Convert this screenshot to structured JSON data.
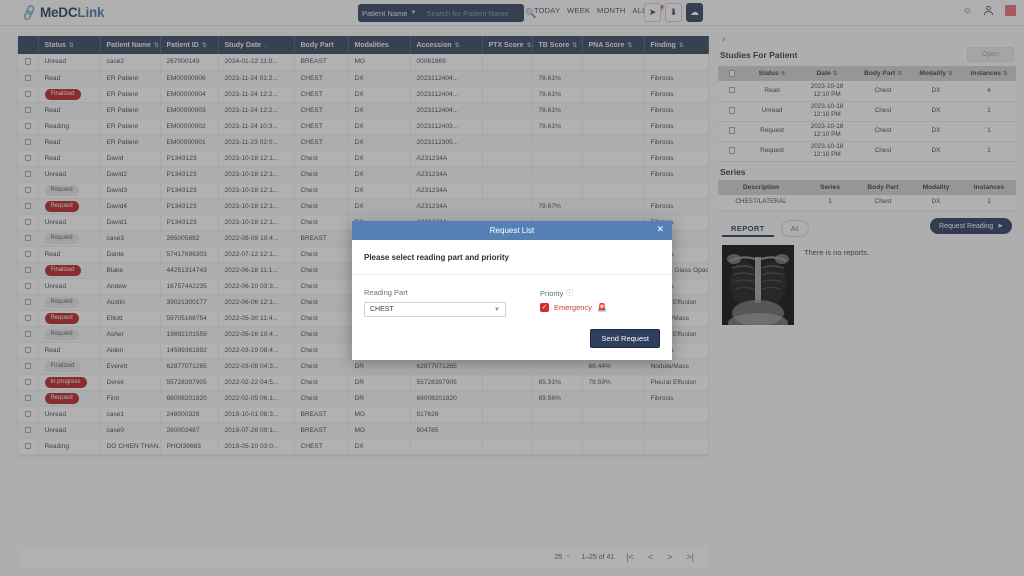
{
  "app": {
    "brand_main": "MeDC",
    "brand_lite": "Link",
    "brand_icon": "link-icon"
  },
  "header": {
    "search_scope": "Patient Name",
    "search_placeholder": "Search for Patient Name",
    "search_value": "",
    "search_icon": "search-icon",
    "date_filters": [
      "TODAY",
      "WEEK",
      "MONTH",
      "ALL"
    ],
    "calendar_icon": "calendar-icon",
    "icon_buttons": [
      "send-icon",
      "download-icon",
      "cloud-upload-icon"
    ],
    "right_icons": [
      "brightness-icon",
      "user-icon",
      "app-square-icon"
    ]
  },
  "worklist": {
    "columns": [
      "Status",
      "Patient Name",
      "Patient ID",
      "Study Date",
      "Body Part",
      "Modalities",
      "Accession",
      "PTX Score",
      "TB Score",
      "PNA Score",
      "Finding"
    ],
    "sorted_column": "Study Date",
    "sort_direction": "desc",
    "rows": [
      {
        "status": "Unread",
        "badge": "none",
        "name": "case2",
        "id": "267000149",
        "date": "2024-01-12 11:0...",
        "body": "BREAST",
        "mod": "MG",
        "acc": "00061869",
        "ptx": "",
        "tb": "",
        "pna": "",
        "finding": ""
      },
      {
        "status": "Read",
        "badge": "none",
        "name": "ER Patient",
        "id": "EM00000006",
        "date": "2023-11-24 01:2...",
        "body": "CHEST",
        "mod": "DX",
        "acc": "2023112404...",
        "ptx": "",
        "tb": "78.61%",
        "pna": "",
        "finding": "Fibrosis"
      },
      {
        "status": "Finalized",
        "badge": "red",
        "name": "ER Patient",
        "id": "EM00000004",
        "date": "2023-11-24 12:2...",
        "body": "CHEST",
        "mod": "DX",
        "acc": "2023112404...",
        "ptx": "",
        "tb": "78.61%",
        "pna": "",
        "finding": "Fibrosis"
      },
      {
        "status": "Read",
        "badge": "none",
        "name": "ER Patient",
        "id": "EM00000003",
        "date": "2023-11-24 12:2...",
        "body": "CHEST",
        "mod": "DX",
        "acc": "2023112404...",
        "ptx": "",
        "tb": "78.61%",
        "pna": "",
        "finding": "Fibrosis"
      },
      {
        "status": "Reading",
        "badge": "none",
        "name": "ER Patient",
        "id": "EM00000002",
        "date": "2023-11-24 10:3...",
        "body": "CHEST",
        "mod": "DX",
        "acc": "2023112403...",
        "ptx": "",
        "tb": "78.61%",
        "pna": "",
        "finding": "Fibrosis"
      },
      {
        "status": "Read",
        "badge": "none",
        "name": "ER Patient",
        "id": "EM00000001",
        "date": "2023-11-23 02:0...",
        "body": "CHEST",
        "mod": "DX",
        "acc": "2023112305...",
        "ptx": "",
        "tb": "",
        "pna": "",
        "finding": "Fibrosis"
      },
      {
        "status": "Read",
        "badge": "none",
        "name": "David",
        "id": "P1343123",
        "date": "2023-10-18 12:1...",
        "body": "Chest",
        "mod": "DX",
        "acc": "A231234A",
        "ptx": "",
        "tb": "",
        "pna": "",
        "finding": "Fibrosis"
      },
      {
        "status": "Unread",
        "badge": "none",
        "name": "David2",
        "id": "P1343123",
        "date": "2023-10-18 12:1...",
        "body": "Chest",
        "mod": "DX",
        "acc": "A231234A",
        "ptx": "",
        "tb": "",
        "pna": "",
        "finding": "Fibrosis"
      },
      {
        "status": "Request",
        "badge": "grey",
        "name": "David3",
        "id": "P1343123",
        "date": "2023-10-18 12:1...",
        "body": "Chest",
        "mod": "DX",
        "acc": "A231234A",
        "ptx": "",
        "tb": "",
        "pna": "",
        "finding": ""
      },
      {
        "status": "Request",
        "badge": "red",
        "name": "David4",
        "id": "P1343123",
        "date": "2023-10-18 12:1...",
        "body": "Chest",
        "mod": "DX",
        "acc": "A231234A",
        "ptx": "",
        "tb": "79.67%",
        "pna": "",
        "finding": "Fibrosis"
      },
      {
        "status": "Unread",
        "badge": "none",
        "name": "David1",
        "id": "P1343123",
        "date": "2023-10-18 12:1...",
        "body": "Chest",
        "mod": "DX",
        "acc": "A231234A",
        "ptx": "",
        "tb": "",
        "pna": "",
        "finding": "Fibrosis"
      },
      {
        "status": "Request",
        "badge": "grey",
        "name": "case3",
        "id": "265005882",
        "date": "2022-08-09 10:4...",
        "body": "BREAST",
        "mod": "",
        "acc": "",
        "ptx": "",
        "tb": "",
        "pna": "",
        "finding": ""
      },
      {
        "status": "Read",
        "badge": "none",
        "name": "Dante",
        "id": "57417696303",
        "date": "2022-07-12 12:1...",
        "body": "Chest",
        "mod": "",
        "acc": "",
        "ptx": "",
        "tb": "",
        "pna": "",
        "finding": "Fibrosis"
      },
      {
        "status": "Finalized",
        "badge": "red",
        "name": "Blake",
        "id": "44251314743",
        "date": "2022-06-18 11:1...",
        "body": "Chest",
        "mod": "",
        "acc": "",
        "ptx": "",
        "tb": "",
        "pna": "",
        "finding": "Ground Glass Opacity"
      },
      {
        "status": "Unread",
        "badge": "none",
        "name": "Andew",
        "id": "16757442235",
        "date": "2022-06-10 03:3...",
        "body": "Chest",
        "mod": "",
        "acc": "",
        "ptx": "",
        "tb": "",
        "pna": "",
        "finding": "Fibrosis"
      },
      {
        "status": "Request",
        "badge": "grey",
        "name": "Austin",
        "id": "39021300177",
        "date": "2022-06-06 12:1...",
        "body": "Chest",
        "mod": "",
        "acc": "",
        "ptx": "",
        "tb": "",
        "pna": "",
        "finding": "Pleural Effusion"
      },
      {
        "status": "Request",
        "badge": "red",
        "name": "Elliott",
        "id": "59705168754",
        "date": "2022-05-30 11:4...",
        "body": "Chest",
        "mod": "",
        "acc": "",
        "ptx": "",
        "tb": "",
        "pna": "",
        "finding": "Nodule/Mass"
      },
      {
        "status": "Request",
        "badge": "grey",
        "name": "Asher",
        "id": "19892101559",
        "date": "2022-05-16 10:4...",
        "body": "Chest",
        "mod": "",
        "acc": "",
        "ptx": "",
        "tb": "",
        "pna": "",
        "finding": "Pleural Effusion"
      },
      {
        "status": "Read",
        "badge": "none",
        "name": "Aiden",
        "id": "14599361892",
        "date": "2022-03-19 08:4...",
        "body": "Chest",
        "mod": "",
        "acc": "",
        "ptx": "",
        "tb": "",
        "pna": "",
        "finding": "Fibrosis"
      },
      {
        "status": "Finalized",
        "badge": "grey",
        "name": "Everett",
        "id": "62877071265",
        "date": "2022-03-08 04:3...",
        "body": "Chest",
        "mod": "DR",
        "acc": "62877071265",
        "ptx": "",
        "tb": "",
        "pna": "66.44%",
        "finding": "Nodule/Mass"
      },
      {
        "status": "In progress",
        "badge": "red",
        "name": "Derek",
        "id": "55728397905",
        "date": "2022-02-22 04:5...",
        "body": "Chest",
        "mod": "DR",
        "acc": "55728397905",
        "ptx": "",
        "tb": "65.31%",
        "pna": "79.59%",
        "finding": "Pleural Effusion"
      },
      {
        "status": "Request",
        "badge": "red",
        "name": "Finn",
        "id": "68008201820",
        "date": "2022-02-05 06:1...",
        "body": "Chest",
        "mod": "DR",
        "acc": "68008201820",
        "ptx": "",
        "tb": "89.56%",
        "pna": "",
        "finding": "Fibrosis"
      },
      {
        "status": "Unread",
        "badge": "none",
        "name": "case1",
        "id": "248000328",
        "date": "2019-10-01 08:3...",
        "body": "BREAST",
        "mod": "MG",
        "acc": "517626",
        "ptx": "",
        "tb": "",
        "pna": "",
        "finding": ""
      },
      {
        "status": "Unread",
        "badge": "none",
        "name": "case0",
        "id": "260002487",
        "date": "2019-07-26 09:1...",
        "body": "BREAST",
        "mod": "MG",
        "acc": "504785",
        "ptx": "",
        "tb": "",
        "pna": "",
        "finding": ""
      },
      {
        "status": "Reading",
        "badge": "none",
        "name": "DO CHIEN THAN...",
        "id": "PHOI39683",
        "date": "2019-05-10 03:0...",
        "body": "CHEST",
        "mod": "DX",
        "acc": "",
        "ptx": "",
        "tb": "",
        "pna": "",
        "finding": ""
      }
    ]
  },
  "pagination": {
    "rows_per_page": "25",
    "range_label": "1–25 of 41",
    "first_icon": "|<",
    "prev_icon": "<",
    "next_icon": ">",
    "last_icon": ">|"
  },
  "right_panel": {
    "expand_icon": "chevron-right-icon",
    "studies_title": "Studies For Patient",
    "open_button": "Open",
    "studies_columns": [
      "Status",
      "Date",
      "Body Part",
      "Modality",
      "Instances"
    ],
    "studies_rows": [
      {
        "status": "Read",
        "date": "2023-10-18 12:10 PM",
        "body": "Chest",
        "mod": "DX",
        "inst": "4"
      },
      {
        "status": "Unread",
        "date": "2023-10-18 12:10 PM",
        "body": "Chest",
        "mod": "DX",
        "inst": "1"
      },
      {
        "status": "Request",
        "date": "2023-10-18 12:10 PM",
        "body": "Chest",
        "mod": "DX",
        "inst": "1"
      },
      {
        "status": "Request",
        "date": "2023-10-18 12:10 PM",
        "body": "Chest",
        "mod": "DX",
        "inst": "1"
      }
    ],
    "series_title": "Series",
    "series_columns": [
      "Description",
      "Series",
      "Body Part",
      "Modality",
      "Instances"
    ],
    "series_rows": [
      {
        "desc": "CHEST/LATERAL",
        "series": "1",
        "body": "Chest",
        "mod": "DX",
        "inst": "1"
      }
    ],
    "tabs": [
      {
        "label": "REPORT",
        "active": true
      },
      {
        "label": "AI",
        "active": false
      }
    ],
    "request_reading_label": "Request Reading",
    "request_reading_icon": "send-icon",
    "thumbnail_name": "chest-xray-thumbnail",
    "no_report_text": "There is no reports."
  },
  "modal": {
    "title": "Request List",
    "close_icon": "close-icon",
    "prompt": "Please select reading part and priority",
    "reading_part_label": "Reading Part",
    "reading_part_value": "CHEST",
    "priority_label": "Priority",
    "priority_help_icon": "help-circle-icon",
    "priority_checked": true,
    "priority_option": "Emergency",
    "priority_icon": "siren-icon",
    "send_label": "Send Request"
  },
  "colors": {
    "navy": "#2f3e5c",
    "modal_header": "#5480b5",
    "badge_red": "#b81d20",
    "emergency_red": "#d32a2a",
    "accent_pink": "#f16a74"
  }
}
